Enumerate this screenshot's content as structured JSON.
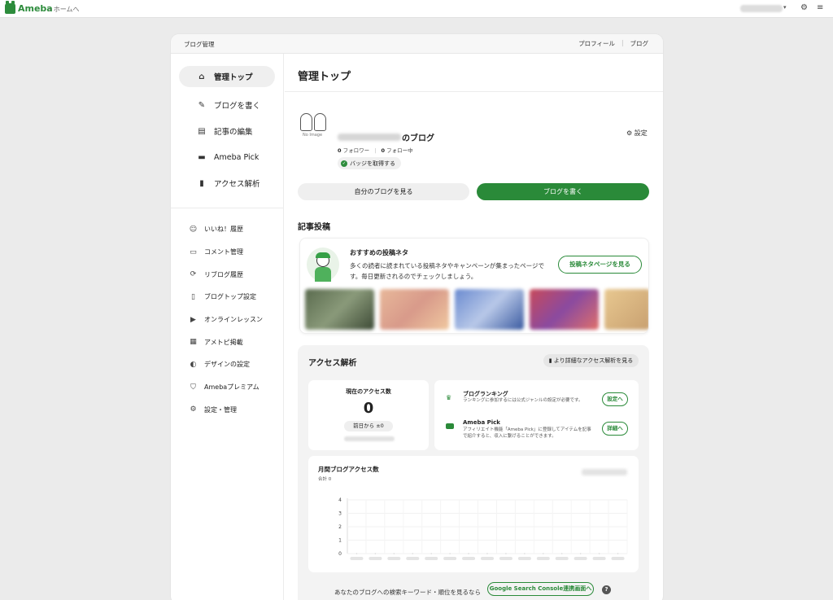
{
  "topbar": {
    "brand": "Ameba",
    "breadcrumb": "› ホームへ",
    "icons": [
      "gear-icon",
      "menu-icon"
    ]
  },
  "card_header": {
    "title": "ブログ管理",
    "links": [
      "プロフィール",
      "ブログ"
    ]
  },
  "sidebar": {
    "main_items": [
      {
        "label": "管理トップ",
        "icon": "home-icon",
        "active": true
      },
      {
        "label": "ブログを書く",
        "icon": "pen-icon"
      },
      {
        "label": "記事の編集",
        "icon": "document-icon"
      },
      {
        "label": "Ameba Pick",
        "icon": "pick-icon"
      },
      {
        "label": "アクセス解析",
        "icon": "bar-chart-icon"
      }
    ],
    "sub_items": [
      {
        "label": "いいね！履歴",
        "icon": "smile-icon"
      },
      {
        "label": "コメント管理",
        "icon": "comment-icon"
      },
      {
        "label": "リブログ履歴",
        "icon": "reblog-icon"
      },
      {
        "label": "ブログトップ設定",
        "icon": "page-settings-icon"
      },
      {
        "label": "オンラインレッスン",
        "icon": "video-icon"
      },
      {
        "label": "アメトピ掲載",
        "icon": "news-icon"
      },
      {
        "label": "デザインの設定",
        "icon": "palette-icon"
      },
      {
        "label": "Amebaプレミアム",
        "icon": "shield-icon"
      },
      {
        "label": "設定・管理",
        "icon": "gear-icon"
      }
    ]
  },
  "main": {
    "title": "管理トップ",
    "profile": {
      "no_image": "No Image",
      "blog_suffix": "のブログ",
      "followers": "0",
      "followers_label": "フォロワー",
      "following": "0",
      "following_label": "フォロー中",
      "badge_button": "バッジを取得する",
      "settings": "設定"
    },
    "buttons": {
      "view_blog": "自分のブログを見る",
      "write_blog": "ブログを書く"
    },
    "post_section": {
      "title": "記事投稿",
      "neta_title": "おすすめの投稿ネタ",
      "neta_desc": "多くの読者に読まれている投稿ネタやキャンペーンが集まったページです。毎日更新されるのでチェックしましょう。",
      "neta_button": "投稿ネタページを見る"
    },
    "access": {
      "title": "アクセス解析",
      "more_button": "より詳細なアクセス解析を見る",
      "current_label": "現在のアクセス数",
      "current_value": "0",
      "prev_day": "前日から ±0",
      "ranking_title": "ブログランキング",
      "ranking_desc": "ランキングに参加するには公式ジャンルの設定が必要です。",
      "ranking_button": "設定へ",
      "pick_title": "Ameba Pick",
      "pick_desc": "アフィリエイト機能「Ameba Pick」に登録してアイテムを記事で紹介すると、収入に繋げることができます。",
      "pick_button": "詳細へ",
      "monthly_title": "月間ブログアクセス数",
      "monthly_total": "合計 0",
      "search_text": "あなたのブログへの検索キーワード・順位を見るなら",
      "gsc_button": "Google Search Console連携画面へ",
      "help": "?"
    }
  },
  "chart_data": {
    "type": "line",
    "title": "月間ブログアクセス数",
    "x": [
      "",
      "",
      "",
      "",
      "",
      "",
      "",
      "",
      "",
      "",
      "",
      "",
      "",
      "",
      ""
    ],
    "series": [
      {
        "values": [
          0,
          0,
          0,
          0,
          0,
          0,
          0,
          0,
          0,
          0,
          0,
          0,
          0,
          0,
          0
        ]
      }
    ],
    "ylim": [
      0,
      4
    ],
    "yticks": [
      "0",
      "1",
      "2",
      "3",
      "4"
    ],
    "grid": true
  },
  "colors": {
    "accent": "#2a8a39",
    "background": "#ebebeb"
  }
}
